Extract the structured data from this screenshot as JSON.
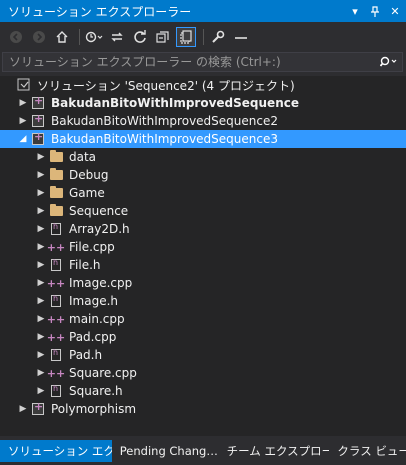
{
  "window": {
    "title": "ソリューション エクスプローラー",
    "btn_menu": "▾",
    "btn_pin": "ᚨ",
    "btn_close": "✕"
  },
  "toolbar": {
    "icons": [
      "back-icon",
      "forward-icon",
      "home-icon",
      "history-icon",
      "sync-icon",
      "refresh-icon",
      "collapse-all-icon",
      "show-all-files-icon",
      "properties-icon",
      "preview-icon"
    ]
  },
  "search": {
    "placeholder": "ソリューション エクスプローラー の検索 (Ctrl+:)"
  },
  "tree": {
    "solution": "ソリューション 'Sequence2' (4 プロジェクト)",
    "projects": [
      "BakudanBitoWithImprovedSequence",
      "BakudanBitoWithImprovedSequence2",
      "BakudanBitoWithImprovedSequence3",
      "Polymorphism"
    ],
    "folders": [
      "data",
      "Debug",
      "Game",
      "Sequence"
    ],
    "files": [
      "Array2D.h",
      "File.cpp",
      "File.h",
      "Image.cpp",
      "Image.h",
      "main.cpp",
      "Pad.cpp",
      "Pad.h",
      "Square.cpp",
      "Square.h"
    ]
  },
  "tabs": {
    "solution_explorer": "ソリューション エク…",
    "pending_changes": "Pending Chang…",
    "team_explorer": "チーム エクスプロー…",
    "class_view": "クラス ビュー"
  }
}
